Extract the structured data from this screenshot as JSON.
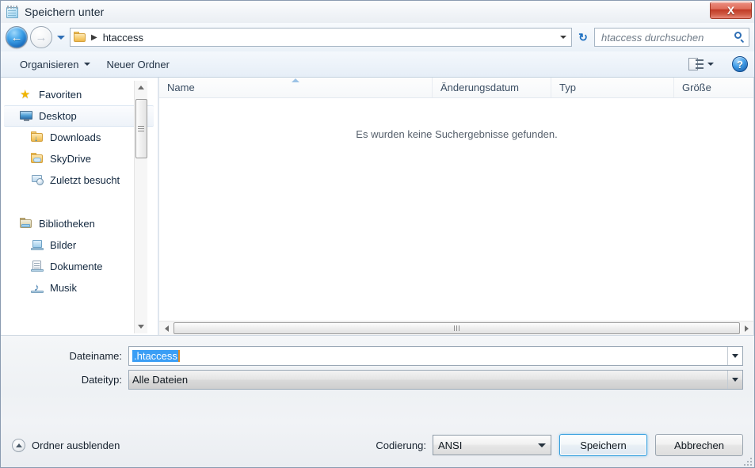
{
  "window": {
    "title": "Speichern unter",
    "app_icon": "notepad-icon",
    "close_label": "X"
  },
  "nav": {
    "back_icon": "back-arrow-icon",
    "forward_icon": "forward-arrow-icon",
    "recent_icon": "chevron-down-icon",
    "address": {
      "folder_icon": "folder-icon",
      "separator": "▶",
      "crumb": "htaccess",
      "dropdown_icon": "chevron-down-icon"
    },
    "refresh_icon": "refresh-icon",
    "refresh_glyph": "↻",
    "search": {
      "placeholder": "htaccess durchsuchen",
      "icon": "search-icon"
    }
  },
  "toolbar": {
    "organize_label": "Organisieren",
    "new_folder_label": "Neuer Ordner",
    "view_icon": "list-view-icon",
    "view_dropdown_icon": "chevron-down-icon",
    "help_icon": "help-icon",
    "help_glyph": "?"
  },
  "sidebar": {
    "groups": [
      {
        "header": {
          "label": "Favoriten",
          "icon": "star-icon"
        },
        "items": [
          {
            "label": "Desktop",
            "icon": "monitor-icon",
            "selected": true
          },
          {
            "label": "Downloads",
            "icon": "downloads-folder-icon",
            "selected": false
          },
          {
            "label": "SkyDrive",
            "icon": "skydrive-folder-icon",
            "selected": false
          },
          {
            "label": "Zuletzt besucht",
            "icon": "recent-places-icon",
            "selected": false
          }
        ]
      },
      {
        "header": {
          "label": "Bibliotheken",
          "icon": "library-folder-icon"
        },
        "items": [
          {
            "label": "Bilder",
            "icon": "pictures-library-icon",
            "selected": false
          },
          {
            "label": "Dokumente",
            "icon": "documents-library-icon",
            "selected": false
          },
          {
            "label": "Musik",
            "icon": "music-library-icon",
            "selected": false
          }
        ]
      }
    ],
    "scrollbar": {
      "up_icon": "scroll-up-icon",
      "down_icon": "scroll-down-icon"
    }
  },
  "filelist": {
    "columns": [
      {
        "label": "Name",
        "sorted": true
      },
      {
        "label": "Änderungsdatum",
        "sorted": false
      },
      {
        "label": "Typ",
        "sorted": false
      },
      {
        "label": "Größe",
        "sorted": false
      }
    ],
    "empty_message": "Es wurden keine Suchergebnisse gefunden.",
    "rows": [],
    "hscroll": {
      "left_icon": "scroll-left-icon",
      "right_icon": "scroll-right-icon"
    }
  },
  "form": {
    "filename_label": "Dateiname:",
    "filename_value": ".htaccess",
    "filename_selected": true,
    "filetype_label": "Dateityp:",
    "filetype_value": "Alle Dateien",
    "dropdown_icon": "chevron-down-icon"
  },
  "footer": {
    "hide_folders_label": "Ordner ausblenden",
    "hide_folders_icon": "chevron-up-circle-icon",
    "encoding_label": "Codierung:",
    "encoding_value": "ANSI",
    "save_label": "Speichern",
    "cancel_label": "Abbrechen",
    "resize_grip_icon": "resize-grip-icon"
  },
  "colors": {
    "selection_blue": "#3a9ef5",
    "close_red": "#c03a26",
    "accent_blue": "#2e9bdc",
    "folder_yellow": "#f8cf74"
  }
}
